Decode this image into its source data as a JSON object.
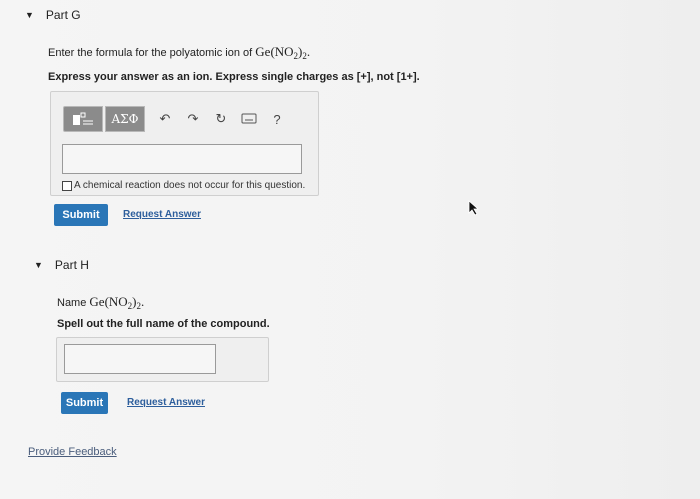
{
  "part_g": {
    "caret": "▼",
    "title": "Part G",
    "prompt_prefix": "Enter the formula for the polyatomic ion of",
    "compound": {
      "base": "Ge(NO",
      "sub": "2",
      "tail": ")",
      "sub2": "2",
      "end": "."
    },
    "instruction": "Express your answer as an ion. Express single charges as [+], not [1+].",
    "toolbar": {
      "template_icon": "template-icon",
      "greek_label": "ΑΣΦ",
      "undo_icon": "undo-icon",
      "redo_icon": "redo-icon",
      "reset_icon": "reset-icon",
      "keyboard_icon": "keyboard-icon",
      "help_label": "?"
    },
    "answer_value": "",
    "checkbox_label": "A chemical reaction does not occur for this question.",
    "submit_label": "Submit",
    "request_label": "Request Answer"
  },
  "part_h": {
    "caret": "▼",
    "title": "Part H",
    "name_prefix": "Name",
    "compound": {
      "base": "Ge(NO",
      "sub": "2",
      "tail": ")",
      "sub2": "2",
      "end": "."
    },
    "instruction": "Spell out the full name of the compound.",
    "answer_value": "",
    "submit_label": "Submit",
    "request_label": "Request Answer"
  },
  "footer": {
    "feedback_label": "Provide Feedback"
  },
  "colors": {
    "submit": "#2a76b7",
    "link": "#2d5e9c",
    "toolbar": "#8b8b8b"
  }
}
